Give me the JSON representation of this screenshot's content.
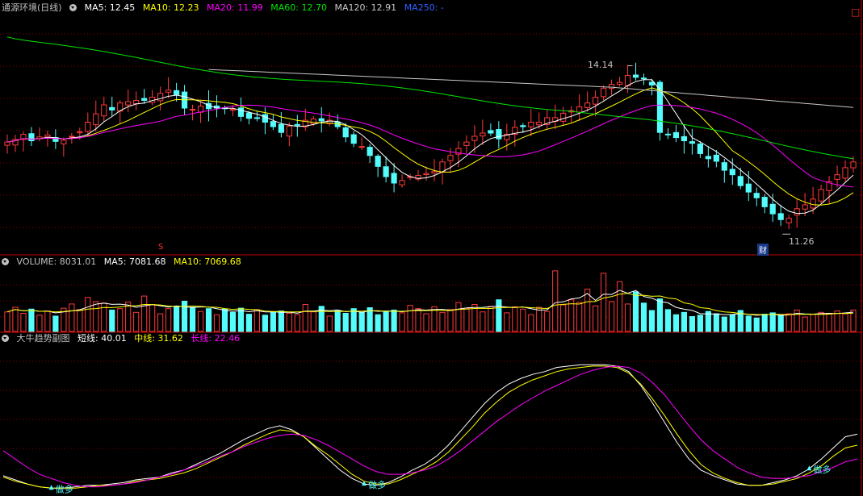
{
  "colors": {
    "bg": "#000000",
    "up": "#ff3a3a",
    "down": "#54fcfc",
    "ma5": "#ffffff",
    "ma10": "#ffff00",
    "ma20": "#ff00ff",
    "ma60": "#00e600",
    "ma120": "#c8c8c8",
    "grid": "#8b0000",
    "sep": "#c00000"
  },
  "main_header": {
    "name": "通源环境(日线)",
    "ma5": "MA5: 12.45",
    "ma10": "MA10: 12.23",
    "ma20": "MA20: 11.99",
    "ma60": "MA60: 12.70",
    "ma120": "MA120: 12.91",
    "ma250": "MA250: -"
  },
  "vol_header": {
    "name": "VOLUME: 8031.01",
    "ma5": "MA5: 7081.68",
    "ma10": "MA10: 7069.68"
  },
  "ind_header": {
    "name": "大牛趋势副图",
    "short": "短线: 40.01",
    "mid": "中线: 31.62",
    "long": "长线: 22.46"
  },
  "annotations": {
    "high": "14.14",
    "low": "11.26",
    "s_marker": "S",
    "cai_marker": "财",
    "signal": "做多"
  },
  "chart_data": [
    {
      "type": "candlestick",
      "title": "通源环境(日线)",
      "ylim": [
        10.9,
        14.6
      ],
      "series_names": [
        "MA5",
        "MA10",
        "MA20",
        "MA60",
        "MA120",
        "MA250"
      ],
      "close": [
        12.61,
        12.65,
        12.73,
        12.63,
        12.69,
        12.72,
        12.62,
        12.64,
        12.7,
        12.77,
        12.92,
        13.05,
        13.19,
        13.11,
        13.22,
        13.24,
        13.26,
        13.26,
        13.31,
        13.37,
        13.42,
        13.35,
        13.14,
        13.12,
        13.17,
        13.13,
        13.14,
        13.13,
        13.12,
        13.01,
        12.98,
        12.98,
        12.92,
        12.85,
        12.76,
        12.86,
        12.88,
        12.95,
        12.97,
        12.94,
        12.95,
        12.85,
        12.69,
        12.59,
        12.54,
        12.4,
        12.23,
        12.07,
        11.97,
        12.01,
        12.07,
        12.09,
        12.12,
        12.15,
        12.3,
        12.4,
        12.51,
        12.61,
        12.7,
        12.75,
        12.75,
        12.66,
        12.73,
        12.84,
        12.85,
        12.92,
        12.92,
        12.99,
        12.99,
        13.06,
        13.1,
        13.16,
        13.22,
        13.31,
        13.45,
        13.51,
        13.54,
        13.65,
        13.62,
        13.6,
        13.5,
        12.76,
        12.73,
        12.68,
        12.63,
        12.59,
        12.43,
        12.35,
        12.31,
        12.17,
        12.1,
        11.93,
        11.83,
        11.74,
        11.6,
        11.49,
        11.4,
        11.42,
        11.57,
        11.63,
        11.72,
        11.87,
        11.99,
        12.1,
        12.21,
        12.3
      ],
      "volume": [
        4200,
        5200,
        3900,
        4800,
        3500,
        4400,
        3300,
        5000,
        5900,
        4700,
        7300,
        6400,
        6100,
        4600,
        4900,
        6300,
        4100,
        7600,
        5800,
        3800,
        4900,
        5400,
        6500,
        5200,
        4300,
        4900,
        3600,
        4800,
        4100,
        5000,
        3700,
        4700,
        3500,
        4200,
        4400,
        3900,
        3600,
        5800,
        4200,
        5400,
        3300,
        4400,
        3900,
        4900,
        4100,
        5100,
        3600,
        4300,
        4600,
        4000,
        5600,
        4900,
        3800,
        5300,
        4100,
        4700,
        6200,
        5000,
        5800,
        4200,
        5400,
        6800,
        4000,
        5300,
        4800,
        3600,
        5200,
        4300,
        13000,
        5700,
        6800,
        6200,
        9100,
        5500,
        12500,
        6400,
        10700,
        5900,
        8500,
        6100,
        4500,
        7000,
        4700,
        3600,
        4100,
        3200,
        3500,
        4300,
        3800,
        3100,
        3600,
        4500,
        3300,
        2900,
        3700,
        4000,
        3400,
        3800,
        4600,
        3100,
        3700,
        4100,
        3900,
        4400,
        3800,
        4600
      ],
      "ylabel": ""
    },
    {
      "type": "line",
      "title": "大牛趋势副图",
      "ylim": [
        0,
        100
      ],
      "series": [
        {
          "name": "短线",
          "values": [
            10,
            7,
            4,
            2,
            1,
            1,
            2,
            3,
            3,
            4,
            5,
            7,
            8,
            9,
            12,
            14,
            18,
            22,
            26,
            31,
            36,
            40,
            44,
            46,
            43,
            38,
            30,
            22,
            14,
            8,
            4,
            3,
            5,
            9,
            14,
            18,
            24,
            32,
            42,
            52,
            62,
            70,
            76,
            80,
            83,
            85,
            88,
            89,
            90,
            90,
            90,
            89,
            85,
            75,
            62,
            48,
            34,
            22,
            14,
            10,
            7,
            4,
            3,
            3,
            5,
            7,
            10,
            15,
            22,
            30,
            38,
            40
          ]
        },
        {
          "name": "中线",
          "values": [
            9,
            6,
            4,
            2,
            1,
            1,
            1,
            2,
            3,
            3,
            4,
            6,
            7,
            8,
            10,
            12,
            15,
            19,
            23,
            27,
            32,
            36,
            40,
            43,
            42,
            38,
            31,
            25,
            18,
            11,
            6,
            4,
            4,
            7,
            11,
            15,
            20,
            27,
            36,
            45,
            55,
            63,
            70,
            75,
            79,
            82,
            85,
            87,
            88,
            89,
            89,
            88,
            84,
            76,
            65,
            53,
            40,
            28,
            18,
            12,
            8,
            5,
            3,
            3,
            4,
            6,
            8,
            12,
            17,
            24,
            30,
            32
          ]
        },
        {
          "name": "长线",
          "values": [
            28,
            22,
            16,
            11,
            8,
            5,
            3,
            2,
            2,
            3,
            4,
            5,
            7,
            9,
            11,
            14,
            17,
            20,
            24,
            27,
            31,
            34,
            37,
            39,
            40,
            39,
            36,
            32,
            27,
            22,
            17,
            13,
            11,
            11,
            12,
            14,
            17,
            22,
            28,
            35,
            42,
            49,
            55,
            61,
            66,
            71,
            75,
            79,
            83,
            86,
            88,
            89,
            88,
            84,
            77,
            68,
            57,
            46,
            36,
            28,
            22,
            16,
            12,
            9,
            8,
            8,
            9,
            10,
            13,
            16,
            20,
            22
          ]
        }
      ],
      "signals": [
        {
          "label": "做多",
          "index": 4
        },
        {
          "label": "做多",
          "index": 30
        },
        {
          "label": "做多",
          "index": 67
        }
      ]
    }
  ]
}
